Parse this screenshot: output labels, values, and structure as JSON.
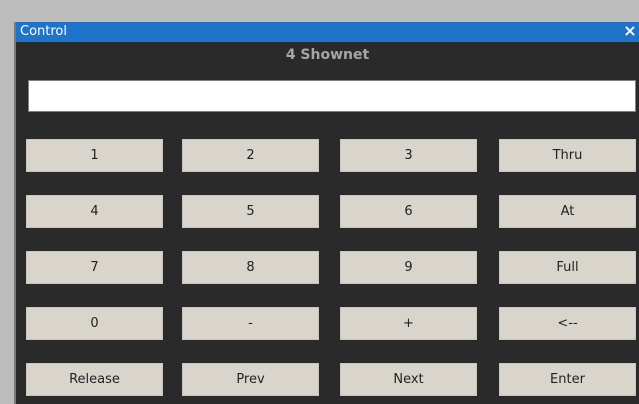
{
  "window": {
    "title": "Control",
    "close_glyph": "×",
    "subtitle": "4 Shownet"
  },
  "command_input": {
    "value": "",
    "placeholder": ""
  },
  "keypad": {
    "rows": [
      [
        "1",
        "2",
        "3",
        "Thru"
      ],
      [
        "4",
        "5",
        "6",
        "At"
      ],
      [
        "7",
        "8",
        "9",
        "Full"
      ],
      [
        "0",
        "-",
        "+",
        "<--"
      ],
      [
        "Release",
        "Prev",
        "Next",
        "Enter"
      ]
    ]
  },
  "colors": {
    "titlebar": "#1f74c9",
    "window_background": "#2a2a2a",
    "button_face": "#d9d5cd",
    "subtitle_text": "#a6a6a6"
  }
}
